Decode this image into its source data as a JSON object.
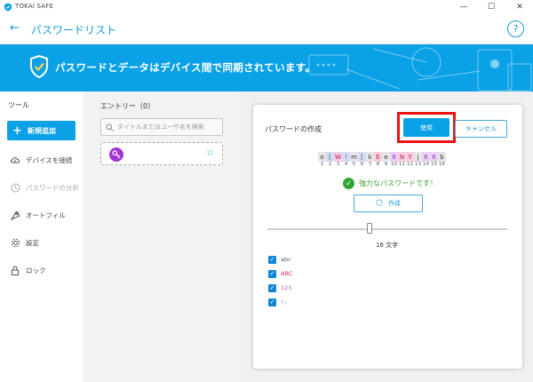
{
  "window": {
    "title": "TOKAI SAFE",
    "minimize": "—",
    "maximize": "☐",
    "close": "✕"
  },
  "header": {
    "back": "←",
    "title": "パスワードリスト",
    "help": "?"
  },
  "banner": {
    "text": "パスワードとデータはデバイス間で同期されています。"
  },
  "sidebar": {
    "heading": "ツール",
    "new_button": "新規追加",
    "items": [
      {
        "label": "デバイスを接続",
        "icon": "cloud-sync-icon",
        "enabled": true
      },
      {
        "label": "パスワードの分析",
        "icon": "analysis-icon",
        "enabled": false
      },
      {
        "label": "オートフィル",
        "icon": "autofill-icon",
        "enabled": true
      },
      {
        "label": "設定",
        "icon": "gear-icon",
        "enabled": true
      },
      {
        "label": "ロック",
        "icon": "lock-icon",
        "enabled": true
      }
    ]
  },
  "entries": {
    "heading": "エントリー（0）",
    "search_placeholder": "タイトルまたはユーザ名を検索"
  },
  "generator": {
    "title": "パスワードの作成",
    "use_button": "使用",
    "cancel_button": "キャンセル",
    "password_chars": [
      "o",
      "[",
      "W",
      "!",
      "m",
      "[",
      "k",
      "E",
      "e",
      "8",
      "N",
      "Y",
      "j",
      "6",
      "6",
      "b"
    ],
    "char_types": [
      "lower",
      "symbol",
      "upper",
      "symbol",
      "lower",
      "symbol",
      "lower",
      "upper",
      "lower",
      "digit",
      "upper",
      "upper",
      "lower",
      "digit",
      "digit",
      "lower"
    ],
    "positions": [
      "1",
      "2",
      "3",
      "4",
      "5",
      "6",
      "7",
      "8",
      "9",
      "10",
      "11",
      "12",
      "13",
      "14",
      "15",
      "16"
    ],
    "strength_text": "強力なパスワードです！",
    "generate_button": "作成",
    "length_label": "16 文字",
    "length": 16,
    "options": [
      {
        "label": "abc",
        "checked": true,
        "color": "#555555"
      },
      {
        "label": "ABC",
        "checked": true,
        "color": "#e0245e"
      },
      {
        "label": "123",
        "checked": true,
        "color": "#c94fd8"
      },
      {
        "label": "!-,",
        "checked": true,
        "color": "#7a86c8"
      }
    ]
  },
  "colors": {
    "accent": "#0aa1e6",
    "highlight": "#ee1111",
    "success": "#2fa633"
  }
}
